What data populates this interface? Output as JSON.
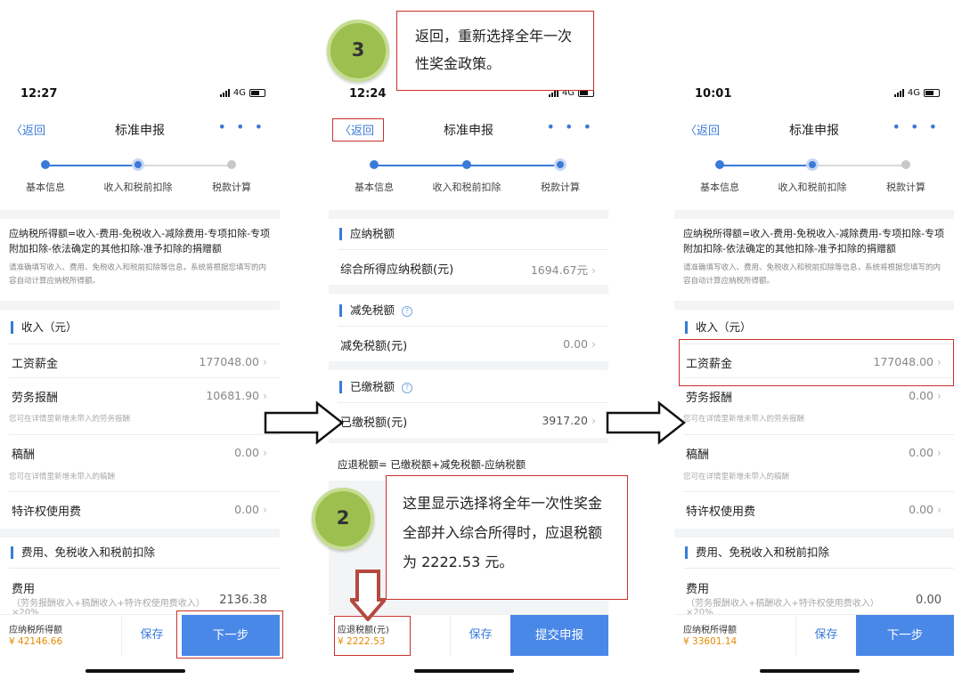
{
  "phone1": {
    "time": "12:27",
    "network": "4G",
    "nav": {
      "back": "〈返回",
      "title": "标准申报",
      "more": "• • •"
    },
    "steps": [
      "基本信息",
      "收入和税前扣除",
      "税款计算"
    ],
    "hint": "应纳税所得额=收入-费用-免税收入-减除费用-专项扣除-专项附加扣除-依法确定的其他扣除-准予扣除的捐赠额",
    "hint_sub": "请准确填写收入、费用、免税收入和税前扣除等信息，系统将根据您填写的内容自动计算应纳税所得额。",
    "income_title": "收入（元）",
    "rows": [
      {
        "label": "工资薪金",
        "value": "177048.00"
      },
      {
        "label": "劳务报酬",
        "value": "10681.90"
      },
      {
        "label": "稿酬",
        "value": "0.00"
      },
      {
        "label": "特许权使用费",
        "value": "0.00"
      }
    ],
    "note_labor": "您可在详情里新增未带入的劳务报酬",
    "note_royalty": "您可在详情里新增未带入的稿酬",
    "expense_title": "费用、免税收入和税前扣除",
    "expense_label": "费用",
    "expense_formula": "（劳务报酬收入+稿酬收入+特许权使用费收入）",
    "expense_value": "2136.38",
    "expense_cut": "×20%",
    "tax_label": "应纳税所得额",
    "tax_value": "¥ 42146.66",
    "save": "保存",
    "next": "下一步"
  },
  "phone2": {
    "time": "12:24",
    "network": "4G",
    "nav": {
      "back": "〈返回",
      "title": "标准申报",
      "more": "• • •"
    },
    "steps": [
      "基本信息",
      "收入和税前扣除",
      "税款计算"
    ],
    "sec1": "应纳税额",
    "row1": {
      "label": "综合所得应纳税额(元)",
      "value": "1694.67元"
    },
    "sec2": "减免税额",
    "row2": {
      "label": "减免税额(元)",
      "value": "0.00"
    },
    "sec3": "已缴税额",
    "row3": {
      "label": "已缴税额(元)",
      "value": "3917.20"
    },
    "formula": "应退税额= 已缴税额+减免税额-应纳税额",
    "refund_label": "应退税额(元)",
    "refund_value": "¥ 2222.53",
    "save": "保存",
    "submit": "提交申报"
  },
  "phone3": {
    "time": "10:01",
    "network": "4G",
    "nav": {
      "back": "〈返回",
      "title": "标准申报",
      "more": "• • •"
    },
    "steps": [
      "基本信息",
      "收入和税前扣除",
      "税款计算"
    ],
    "hint": "应纳税所得额=收入-费用-免税收入-减除费用-专项扣除-专项附加扣除-依法确定的其他扣除-准予扣除的捐赠额",
    "hint_sub": "请准确填写收入、费用、免税收入和税前扣除等信息，系统将根据您填写的内容自动计算应纳税所得额。",
    "income_title": "收入（元）",
    "rows": [
      {
        "label": "工资薪金",
        "value": "177048.00"
      },
      {
        "label": "劳务报酬",
        "value": "0.00"
      },
      {
        "label": "稿酬",
        "value": "0.00"
      },
      {
        "label": "特许权使用费",
        "value": "0.00"
      }
    ],
    "note_labor": "您可在详情里新增未带入的劳务报酬",
    "note_royalty": "您可在详情里新增未带入的稿酬",
    "expense_title": "费用、免税收入和税前扣除",
    "expense_label": "费用",
    "expense_formula": "（劳务报酬收入+稿酬收入+特许权使用费收入）",
    "expense_value": "0.00",
    "expense_cut": "×20%",
    "tax_label": "应纳税所得额",
    "tax_value": "¥ 33601.14",
    "save": "保存",
    "next": "下一步"
  },
  "annotations": {
    "callout_top": "返回，重新选择全年一次性奖金政策。",
    "callout_mid": "这里显示选择将全年一次性奖金全部并入综合所得时，应退税额为 2222.53 元。",
    "circle3": "3",
    "circle2": "2"
  }
}
